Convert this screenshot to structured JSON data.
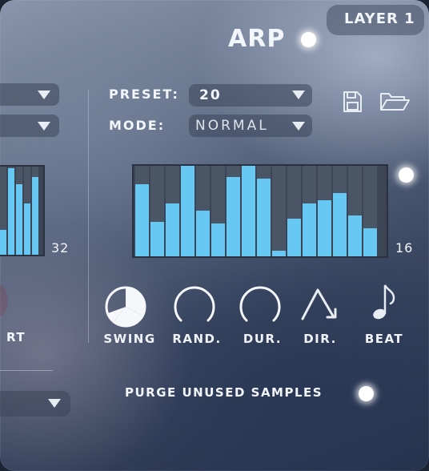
{
  "header": {
    "layer_tab": "LAYER 1",
    "arp_label": "ARP"
  },
  "arp": {
    "preset_label": "PRESET:",
    "preset_value": "20",
    "mode_label": "MODE:",
    "mode_value": "NORMAL"
  },
  "sequencer_main": {
    "step_count_label": "16",
    "values": [
      0.8,
      0.38,
      0.58,
      1.0,
      0.5,
      0.36,
      0.88,
      1.0,
      0.86,
      0.06,
      0.42,
      0.58,
      0.62,
      0.7,
      0.45,
      0.31
    ]
  },
  "sequencer_left": {
    "step_count_label": "32",
    "values": [
      0.28,
      0.98,
      0.8,
      0.58,
      0.88
    ]
  },
  "controls": [
    {
      "label": "SWING",
      "icon": "knob-swing-icon"
    },
    {
      "label": "RAND.",
      "icon": "knob-rand-icon"
    },
    {
      "label": "DUR.",
      "icon": "knob-dur-icon"
    },
    {
      "label": "DIR.",
      "icon": "direction-icon"
    },
    {
      "label": "BEAT",
      "icon": "note-icon"
    }
  ],
  "left_panel": {
    "partial_label": "RT"
  },
  "footer": {
    "purge_label": "PURGE UNUSED SAMPLES"
  },
  "colors": {
    "bar": "#66c8f3",
    "accent_dot": "#ffffff",
    "text": "#f2f5fa"
  }
}
